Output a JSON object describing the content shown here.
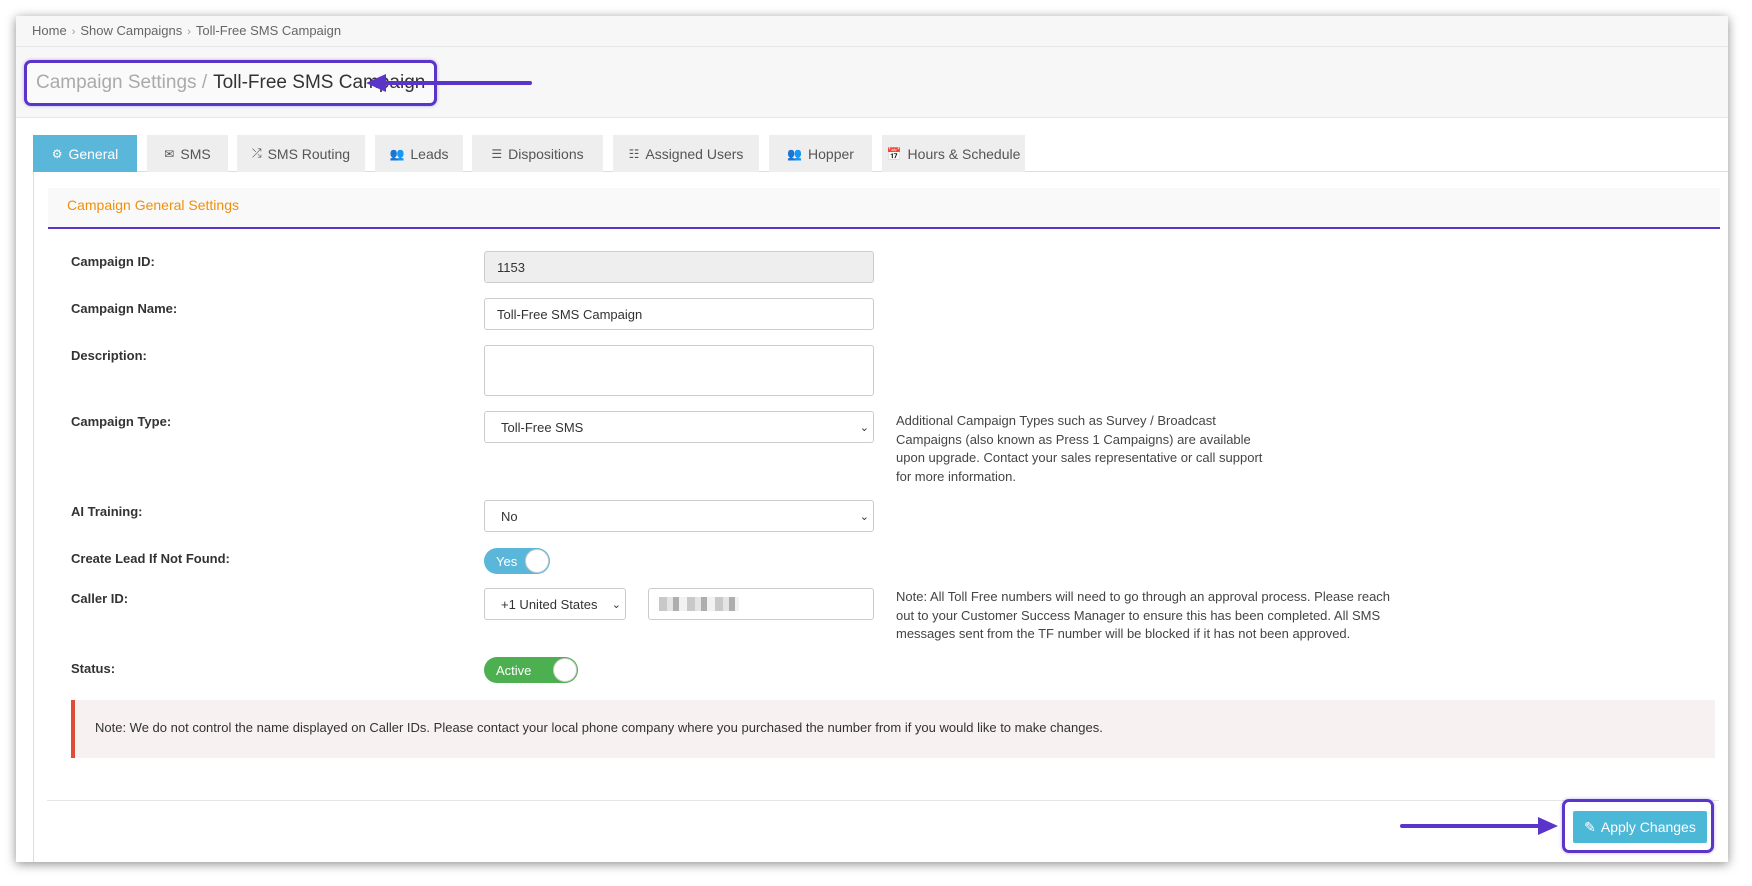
{
  "breadcrumb": [
    "Home",
    "Show Campaigns",
    "Toll-Free SMS Campaign"
  ],
  "breadcrumb_sep": "›",
  "title": {
    "prefix": "Campaign Settings /",
    "name": "Toll-Free SMS Campaign"
  },
  "tabs": [
    {
      "label": "General",
      "icon": "⚙"
    },
    {
      "label": "SMS",
      "icon": "✉"
    },
    {
      "label": "SMS Routing",
      "icon": "⤮"
    },
    {
      "label": "Leads",
      "icon": "👥"
    },
    {
      "label": "Dispositions",
      "icon": "☰"
    },
    {
      "label": "Assigned Users",
      "icon": "☷"
    },
    {
      "label": "Hopper",
      "icon": "👥"
    },
    {
      "label": "Hours & Schedule",
      "icon": "📅"
    }
  ],
  "section_title": "Campaign General Settings",
  "form": {
    "campaign_id": {
      "label": "Campaign ID:",
      "value": "1153"
    },
    "campaign_name": {
      "label": "Campaign Name:",
      "value": "Toll-Free SMS Campaign"
    },
    "description": {
      "label": "Description:",
      "value": ""
    },
    "campaign_type": {
      "label": "Campaign Type:",
      "value": "Toll-Free SMS",
      "help": [
        "Additional Campaign Types such as Survey / Broadcast",
        "Campaigns (also known as Press 1 Campaigns) are available",
        "upon upgrade. Contact your sales representative or call support",
        "for more information."
      ]
    },
    "ai_training": {
      "label": "AI Training:",
      "value": "No"
    },
    "create_lead": {
      "label": "Create Lead If Not Found:",
      "value": "Yes"
    },
    "caller_id": {
      "label": "Caller ID:",
      "country": "+1 United States",
      "help": [
        "Note: All Toll Free numbers will need to go through an approval process. Please reach",
        "out to your Customer Success Manager to ensure this has been completed. All SMS",
        "messages sent from the TF number will be blocked if it has not been approved."
      ]
    },
    "status": {
      "label": "Status:",
      "value": "Active"
    }
  },
  "note": "Note: We do not control the name displayed on Caller IDs. Please contact your local phone company where you purchased the number from if you would like to make changes.",
  "apply_button": {
    "label": "Apply Changes",
    "icon": "✎"
  },
  "colors": {
    "accent_purple": "#5b34c9",
    "tab_active": "#5bb7d9",
    "section_orange": "#f0900a",
    "toggle_yes": "#5bb7d9",
    "toggle_active": "#4caf50",
    "note_border": "#e04c3a"
  }
}
